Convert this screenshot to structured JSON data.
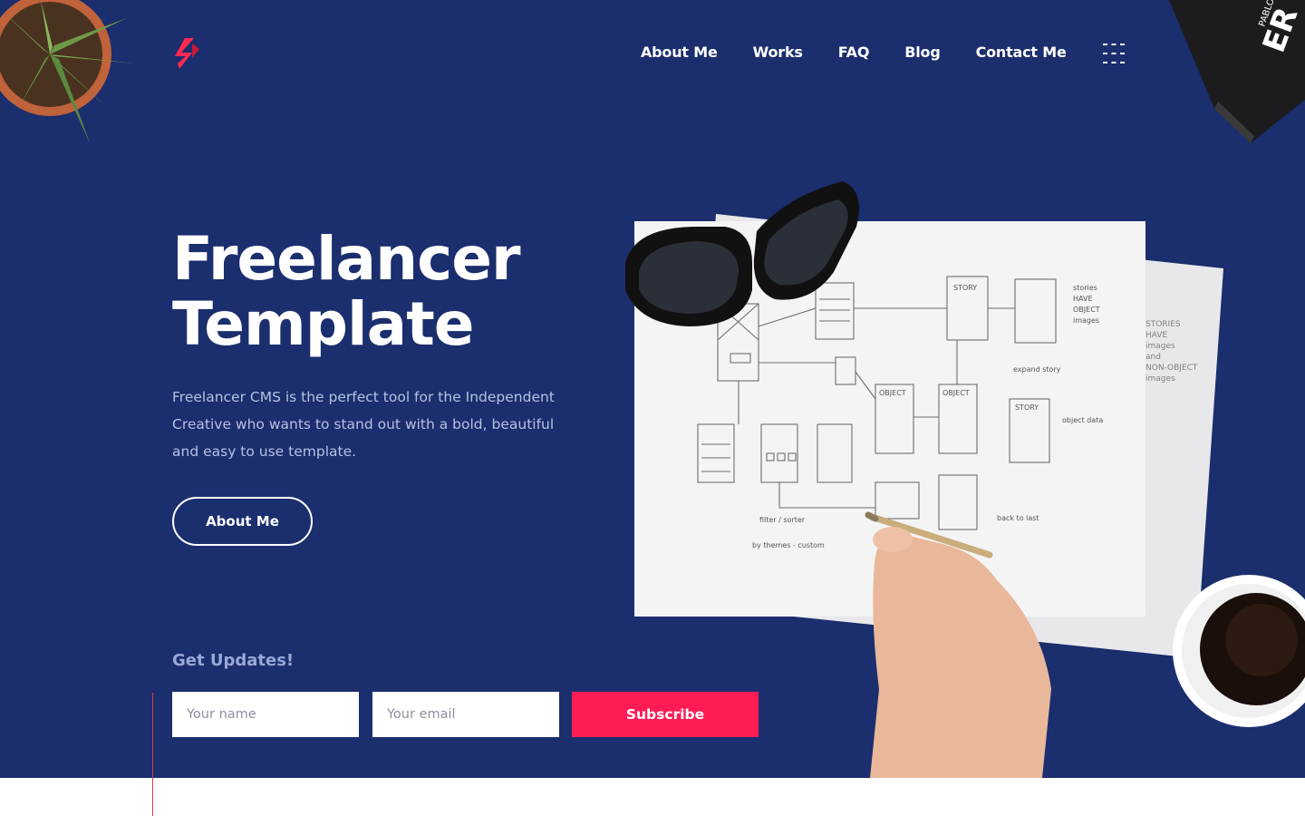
{
  "header": {
    "nav": [
      {
        "label": "About Me"
      },
      {
        "label": "Works"
      },
      {
        "label": "FAQ"
      },
      {
        "label": "Blog"
      },
      {
        "label": "Contact Me"
      }
    ]
  },
  "hero": {
    "title_line1": "Freelancer",
    "title_line2": "Template",
    "description": "Freelancer CMS is the perfect tool for the Independent Creative who wants to stand out with a bold, beautiful and easy to use template.",
    "cta_label": "About Me"
  },
  "newsletter": {
    "title": "Get Updates!",
    "name_placeholder": "Your name",
    "email_placeholder": "Your email",
    "subscribe_label": "Subscribe"
  },
  "colors": {
    "background": "#1b2e6e",
    "accent": "#ff1c55",
    "text_muted": "#b6c1e2"
  },
  "icons": {
    "logo": "brand-logo-icon",
    "menu": "grid-menu-icon"
  }
}
